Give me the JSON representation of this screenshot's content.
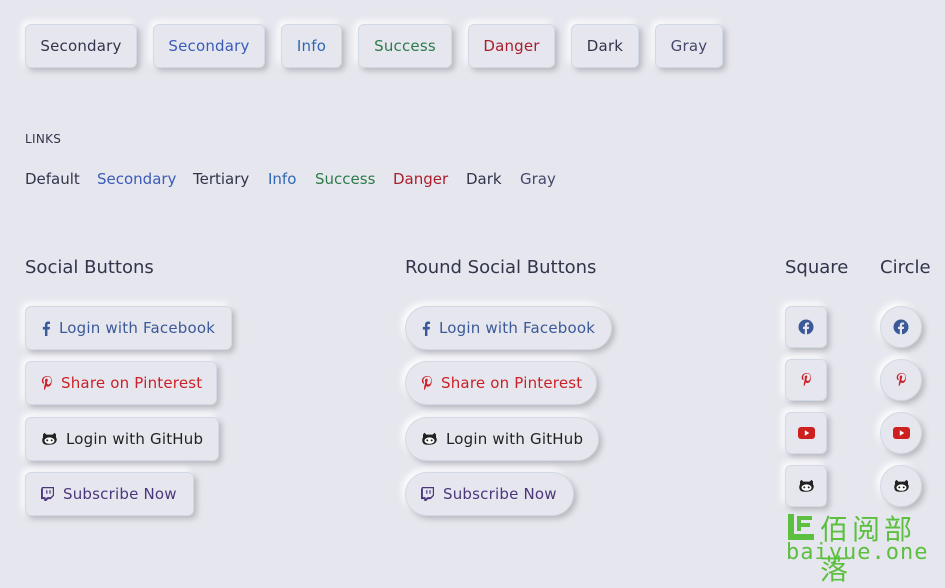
{
  "colors": {
    "bg": "#e6e7ee",
    "secondary_dark": "#31344b",
    "secondary_blue": "#3a5bb8",
    "info": "#2f66b3",
    "success": "#2d7a4a",
    "danger": "#a91e2c",
    "dark": "#31344b",
    "gray": "#44476a",
    "facebook": "#3b5998",
    "pinterest": "#cb2027",
    "github": "#222222",
    "twitch": "#4b367c",
    "youtube": "#cd201f"
  },
  "buttons": [
    {
      "label": "Secondary"
    },
    {
      "label": "Secondary"
    },
    {
      "label": "Info"
    },
    {
      "label": "Success"
    },
    {
      "label": "Danger"
    },
    {
      "label": "Dark"
    },
    {
      "label": "Gray"
    }
  ],
  "links_heading": "LINKS",
  "links": [
    "Default",
    "Secondary",
    "Tertiary",
    "Info",
    "Success",
    "Danger",
    "Dark",
    "Gray"
  ],
  "social": {
    "title": "Social Buttons",
    "round_title": "Round Social Buttons",
    "square_title": "Square",
    "circle_title": "Circle",
    "items": [
      {
        "label": "Login with Facebook",
        "icon": "facebook-f-icon"
      },
      {
        "label": "Share on Pinterest",
        "icon": "pinterest-icon"
      },
      {
        "label": "Login with GitHub",
        "icon": "github-icon"
      },
      {
        "label": "Subscribe Now",
        "icon": "twitch-icon"
      }
    ],
    "icon_buttons": [
      "facebook-icon",
      "pinterest-icon",
      "youtube-icon",
      "github-icon"
    ]
  },
  "watermark": {
    "cn": "佰阅部落",
    "en": "baiyue.one"
  }
}
